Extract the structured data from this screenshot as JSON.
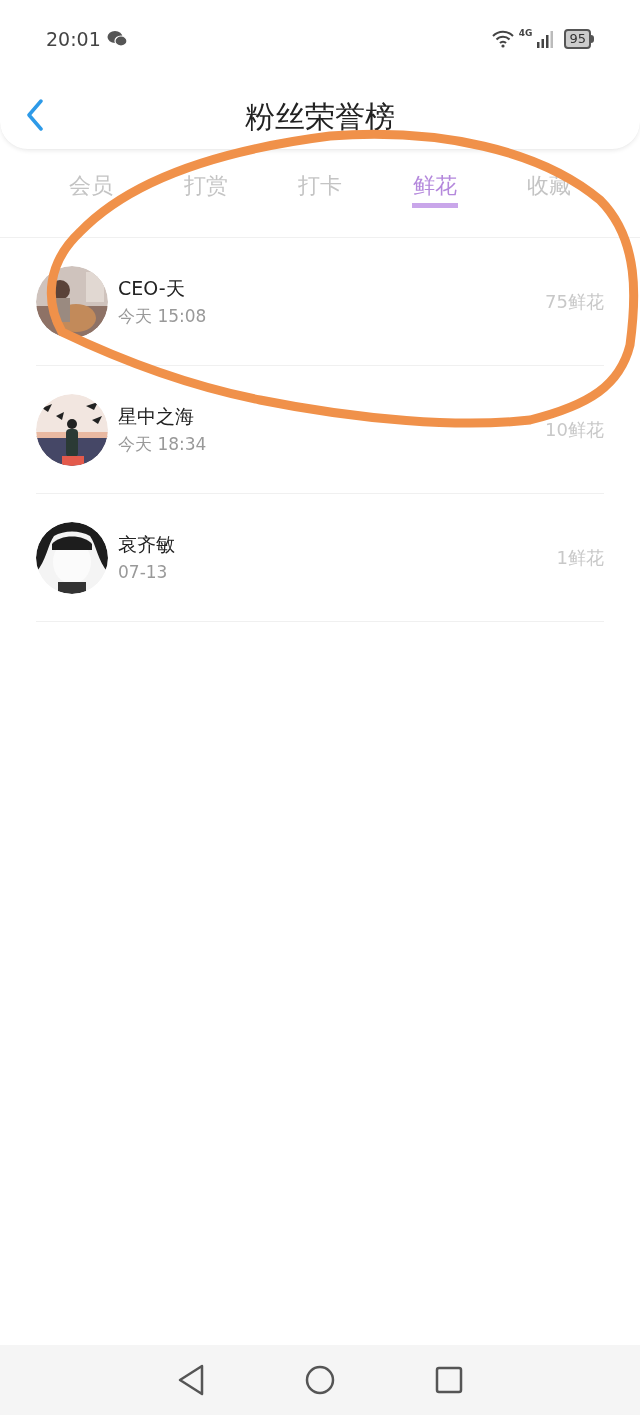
{
  "status_bar": {
    "time": "20:01",
    "network": "4G",
    "battery": "95"
  },
  "header": {
    "title": "粉丝荣誉榜"
  },
  "tabs": [
    {
      "label": "会员",
      "selected": false
    },
    {
      "label": "打赏",
      "selected": false
    },
    {
      "label": "打卡",
      "selected": false
    },
    {
      "label": "鲜花",
      "selected": true
    },
    {
      "label": "收藏",
      "selected": false
    }
  ],
  "rows": [
    {
      "name": "CEO-天",
      "time": "今天 15:08",
      "count": "75鲜花"
    },
    {
      "name": "星中之海",
      "time": "今天 18:34",
      "count": "10鲜花"
    },
    {
      "name": "哀齐敏",
      "time": "07-13",
      "count": "1鲜花"
    }
  ]
}
